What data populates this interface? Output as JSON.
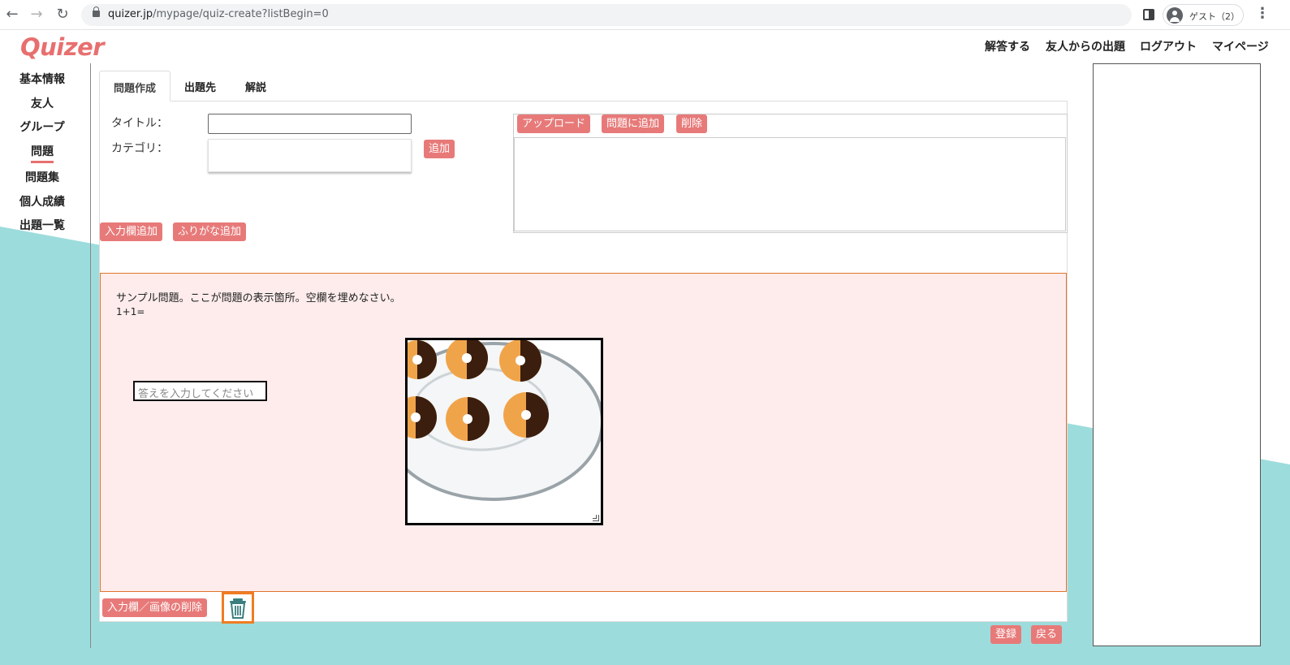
{
  "browser": {
    "url_domain": "quizer.jp",
    "url_path": "/mypage/quiz-create?listBegin=0",
    "profile_label": "ゲスト（2）"
  },
  "header": {
    "logo": "Quizer",
    "nav": [
      "解答する",
      "友人からの出題",
      "ログアウト",
      "マイページ"
    ]
  },
  "sidebar": {
    "items": [
      {
        "label": "基本情報"
      },
      {
        "label": "友人"
      },
      {
        "label": "グループ"
      },
      {
        "label": "問題",
        "active": true
      },
      {
        "label": "問題集"
      },
      {
        "label": "個人成績"
      },
      {
        "label": "出題一覧"
      }
    ]
  },
  "tabs": [
    {
      "label": "問題作成",
      "active": true
    },
    {
      "label": "出題先"
    },
    {
      "label": "解説"
    }
  ],
  "form": {
    "title_label": "タイトル：",
    "title_value": "",
    "category_label": "カテゴリ：",
    "add_category_button": "追加",
    "add_input_button": "入力欄追加",
    "add_furigana_button": "ふりがな追加"
  },
  "upload": {
    "upload_button": "アップロード",
    "add_to_question_button": "問題に追加",
    "delete_button": "削除"
  },
  "question": {
    "text_line1": "サンプル問題。ここが問題の表示箇所。空欄を埋めなさい。",
    "text_line2": "1+1=",
    "answer_placeholder": "答えを入力してください",
    "delete_input_image_button": "入力欄／画像の削除"
  },
  "footer": {
    "register_button": "登録",
    "back_button": "戻る"
  },
  "colors": {
    "accent": "#e77a79",
    "teal": "#9ddcdc",
    "question_bg": "#feecec",
    "highlight": "#f07c22"
  }
}
